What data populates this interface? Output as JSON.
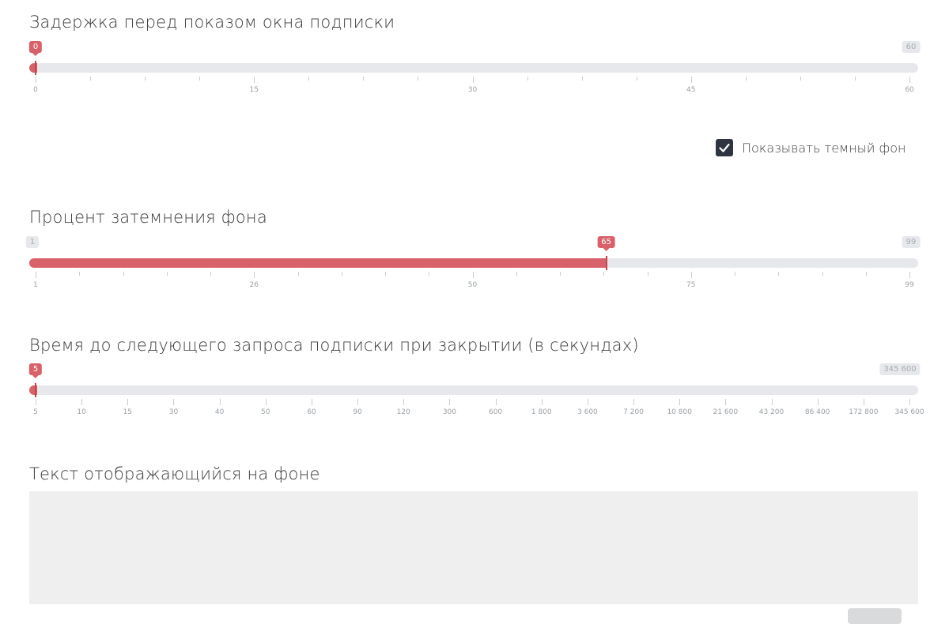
{
  "delay": {
    "title": "Задержка перед показом окна подписки",
    "min": 0,
    "max": 60,
    "value": 0,
    "value_label": "0",
    "max_label": "60",
    "ticks": [
      "0",
      "15",
      "30",
      "45",
      "60"
    ]
  },
  "dark_bg": {
    "label": "Показывать темный фон",
    "checked": true
  },
  "dim": {
    "title": "Процент затемнения фона",
    "min": 1,
    "max": 99,
    "value": 65,
    "min_label": "1",
    "value_label": "65",
    "max_label": "99",
    "ticks": [
      "1",
      "26",
      "50",
      "75",
      "99"
    ]
  },
  "next_request": {
    "title": "Время до следующего запроса подписки при закрытии (в секундах)",
    "value_label": "5",
    "max_label": "345 600",
    "value_index": 0,
    "ticks": [
      "5",
      "10",
      "15",
      "30",
      "40",
      "50",
      "60",
      "90",
      "120",
      "300",
      "600",
      "1 800",
      "3 600",
      "7 200",
      "10 800",
      "21 600",
      "43 200",
      "86 400",
      "172 800",
      "345 600"
    ]
  },
  "bg_text": {
    "title": "Текст отображающийся на фоне",
    "value": ""
  },
  "colors": {
    "accent": "#d9616a",
    "track": "#e6e8eb",
    "checkbox": "#2e3440"
  }
}
